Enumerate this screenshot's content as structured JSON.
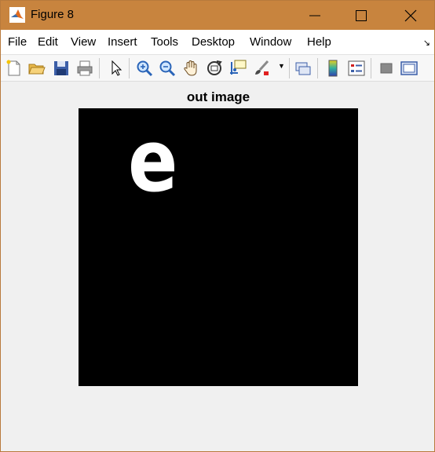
{
  "window": {
    "title": "Figure 8",
    "titlebar_color": "#c8843e",
    "controls": [
      "minimize-icon",
      "maximize-icon",
      "close-icon"
    ]
  },
  "menubar": {
    "items": [
      {
        "label": "File"
      },
      {
        "label": "Edit"
      },
      {
        "label": "View"
      },
      {
        "label": "Insert"
      },
      {
        "label": "Tools"
      },
      {
        "label": "Desktop"
      },
      {
        "label": "Window"
      },
      {
        "label": "Help"
      }
    ],
    "dock_icon": "dock-arrow-icon"
  },
  "toolbar": {
    "buttons": [
      "new-figure-icon",
      "open-file-icon",
      "save-figure-icon",
      "print-figure-icon",
      "edit-plot-icon",
      "zoom-in-icon",
      "zoom-out-icon",
      "pan-icon",
      "rotate-3d-icon",
      "data-cursor-icon",
      "brush-icon",
      "link-plot-icon",
      "insert-colorbar-icon",
      "insert-legend-icon",
      "hide-plot-tools-icon",
      "show-plot-tools-icon"
    ]
  },
  "figure": {
    "axes_title": "out image",
    "image_background": "#000000",
    "image_glyph": "e",
    "glyph_color": "#ffffff"
  }
}
